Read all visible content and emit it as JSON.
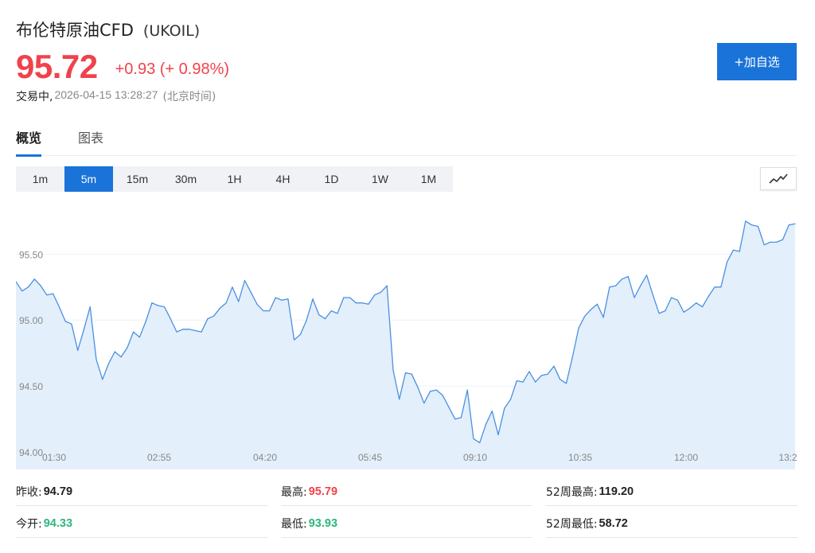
{
  "header": {
    "name": "布伦特原油CFD",
    "symbol": "(UKOIL)",
    "price": "95.72",
    "change": "+0.93 (+ 0.98%)",
    "status": "交易中,",
    "timestamp": "2026-04-15 13:28:27",
    "timezone": "(北京时间)",
    "watch_button": "+加自选"
  },
  "colors": {
    "up": "#f0424b",
    "down": "#2db67e",
    "accent": "#1a73d8",
    "line": "#4a90e2",
    "area": "#e3effb"
  },
  "tabs": [
    {
      "label": "概览",
      "active": true
    },
    {
      "label": "图表",
      "active": false
    }
  ],
  "intervals": [
    {
      "label": "1m",
      "active": false
    },
    {
      "label": "5m",
      "active": true
    },
    {
      "label": "15m",
      "active": false
    },
    {
      "label": "30m",
      "active": false
    },
    {
      "label": "1H",
      "active": false
    },
    {
      "label": "4H",
      "active": false
    },
    {
      "label": "1D",
      "active": false
    },
    {
      "label": "1W",
      "active": false
    },
    {
      "label": "1M",
      "active": false
    }
  ],
  "chart_type_icon": "line-chart-icon",
  "chart_data": {
    "type": "area",
    "x_tick_labels": [
      "01:30",
      "02:55",
      "04:20",
      "05:45",
      "09:10",
      "10:35",
      "12:00",
      "13:2"
    ],
    "y_tick_labels": [
      "94.00",
      "94.50",
      "95.00",
      "95.50"
    ],
    "ylim": [
      94.0,
      95.9
    ],
    "grid": true,
    "values": [
      95.29,
      95.22,
      95.25,
      95.31,
      95.26,
      95.19,
      95.2,
      95.1,
      94.99,
      94.97,
      94.77,
      94.93,
      95.1,
      94.7,
      94.55,
      94.67,
      94.76,
      94.72,
      94.79,
      94.91,
      94.87,
      94.99,
      95.13,
      95.11,
      95.1,
      95.01,
      94.91,
      94.93,
      94.93,
      94.92,
      94.91,
      95.01,
      95.03,
      95.09,
      95.13,
      95.25,
      95.14,
      95.3,
      95.21,
      95.12,
      95.07,
      95.07,
      95.17,
      95.15,
      95.16,
      94.85,
      94.89,
      95.0,
      95.16,
      95.04,
      95.01,
      95.07,
      95.05,
      95.17,
      95.17,
      95.13,
      95.13,
      95.12,
      95.19,
      95.21,
      95.26,
      94.62,
      94.4,
      94.6,
      94.59,
      94.49,
      94.37,
      94.46,
      94.47,
      94.43,
      94.34,
      94.25,
      94.26,
      94.47,
      94.1,
      94.07,
      94.21,
      94.31,
      94.13,
      94.33,
      94.4,
      94.54,
      94.53,
      94.61,
      94.53,
      94.58,
      94.59,
      94.65,
      94.55,
      94.52,
      94.72,
      94.94,
      95.03,
      95.08,
      95.12,
      95.02,
      95.25,
      95.26,
      95.31,
      95.33,
      95.17,
      95.26,
      95.34,
      95.19,
      95.05,
      95.07,
      95.17,
      95.15,
      95.06,
      95.09,
      95.13,
      95.1,
      95.18,
      95.25,
      95.25,
      95.44,
      95.53,
      95.52,
      95.75,
      95.72,
      95.71,
      95.57,
      95.59,
      95.59,
      95.61,
      95.72,
      95.73
    ]
  },
  "stats": {
    "prev_close": {
      "label": "昨收:",
      "value": "94.79"
    },
    "open": {
      "label": "今开:",
      "value": "94.33"
    },
    "high": {
      "label": "最高:",
      "value": "95.79"
    },
    "low": {
      "label": "最低:",
      "value": "93.93"
    },
    "week52_high": {
      "label": "52周最高:",
      "value": "119.20"
    },
    "week52_low": {
      "label": "52周最低:",
      "value": "58.72"
    }
  }
}
